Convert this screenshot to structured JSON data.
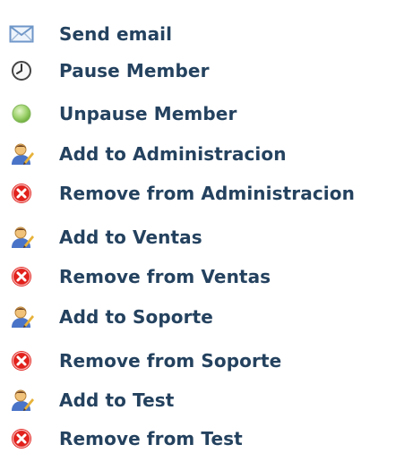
{
  "menu": {
    "items": [
      {
        "label": "Send email",
        "icon": "envelope-icon"
      },
      {
        "label": "Pause Member",
        "icon": "clock-icon"
      },
      {
        "label": "Unpause Member",
        "icon": "green-circle-icon"
      },
      {
        "label": "Add to Administracion",
        "icon": "add-user-icon"
      },
      {
        "label": "Remove from Administracion",
        "icon": "remove-icon"
      },
      {
        "label": "Add to Ventas",
        "icon": "add-user-icon"
      },
      {
        "label": "Remove from Ventas",
        "icon": "remove-icon"
      },
      {
        "label": "Add to Soporte",
        "icon": "add-user-icon"
      },
      {
        "label": "Remove from Soporte",
        "icon": "remove-icon"
      },
      {
        "label": "Add to Test",
        "icon": "add-user-icon"
      },
      {
        "label": "Remove from Test",
        "icon": "remove-icon"
      }
    ]
  },
  "colors": {
    "label_text": "#24425f",
    "remove_red": "#e2211c",
    "unpause_green": "#9fd36e",
    "envelope_blue": "#6e96c8"
  }
}
